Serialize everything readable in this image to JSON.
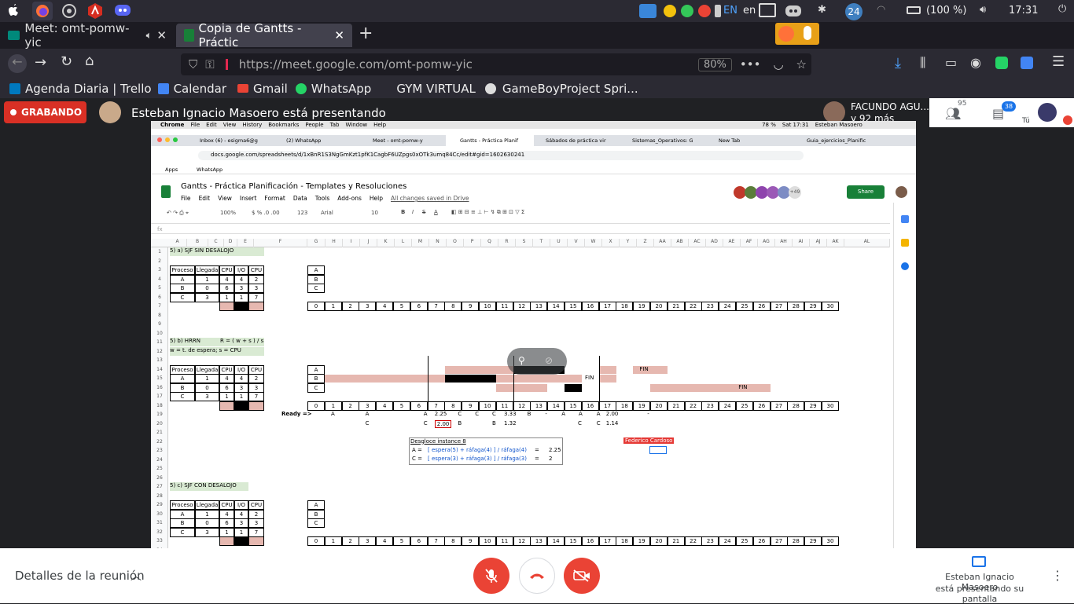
{
  "system": {
    "lang_indicator": "en",
    "battery": "(100 %)",
    "time": "17:31",
    "notif_count": "24"
  },
  "browser": {
    "tabs": [
      {
        "label": "Meet: omt-pomw-yic"
      },
      {
        "label": "Copia de Gantts - Práctic"
      }
    ],
    "url_host": "https://meet.google.com/omt-pomw-yic",
    "zoom": "80%",
    "bookmarks": [
      {
        "label": "Agenda Diaria | Trello"
      },
      {
        "label": "Calendar"
      },
      {
        "label": "Gmail"
      },
      {
        "label": "WhatsApp"
      },
      {
        "label": "GYM VIRTUAL"
      },
      {
        "label": "GameBoyProject Spri..."
      }
    ]
  },
  "meet": {
    "recording_label": "GRABANDO",
    "presenting_text": "Esteban Ignacio Masoero está presentando",
    "participant_name": "FACUNDO AGU...",
    "participant_more": "y 92 más",
    "participants_count": "95",
    "chat_count": "38",
    "you_label": "Tú",
    "meeting_details": "Detalles de la reunión",
    "presenting_status_line1": "Esteban Ignacio Masoero",
    "presenting_status_line2": "está presentando su pantalla"
  },
  "shared_screen": {
    "mac_menu": [
      "Chrome",
      "File",
      "Edit",
      "View",
      "History",
      "Bookmarks",
      "People",
      "Tab",
      "Window",
      "Help"
    ],
    "mac_time": "Sat 17:31",
    "mac_user": "Esteban Masoero",
    "mac_battery": "78 %",
    "chrome_tabs": [
      {
        "label": "Inbox (6) - esigma6@g"
      },
      {
        "label": "(2) WhatsApp"
      },
      {
        "label": "Meet - omt-pomw-y"
      },
      {
        "label": "Gantts - Práctica Planif"
      },
      {
        "label": "Sábados de práctica vir"
      },
      {
        "label": "Sistemas_Operativos: G"
      },
      {
        "label": "New Tab"
      },
      {
        "label": "Guia_ejercicios_Planific"
      }
    ],
    "chrome_url": "docs.google.com/spreadsheets/d/1xBnR1S3NgGmKzt1pfK1CagbF6UZpgs0xOTk3umq84Cc/edit#gid=1602630241",
    "chrome_bookmarks": [
      "Apps",
      "WhatsApp"
    ],
    "doc_title": "Gantts - Práctica Planificación - Templates y Resoluciones",
    "doc_menus": [
      "File",
      "Edit",
      "View",
      "Insert",
      "Format",
      "Data",
      "Tools",
      "Add-ons",
      "Help"
    ],
    "saved_status": "All changes saved in Drive",
    "share_label": "Share",
    "more_collaborators": "+49",
    "toolbar": {
      "zoom": "100%",
      "font": "Arial",
      "size": "10",
      "num_format": "123"
    },
    "fx": "fx",
    "columns": [
      "A",
      "B",
      "C",
      "D",
      "E",
      "F",
      "G",
      "H",
      "I",
      "J",
      "K",
      "L",
      "M",
      "N",
      "O",
      "P",
      "Q",
      "R",
      "S",
      "T",
      "U",
      "V",
      "W",
      "X",
      "Y",
      "Z",
      "AA",
      "AB",
      "AC",
      "AD",
      "AE",
      "AF",
      "AG",
      "AH",
      "AI",
      "AJ",
      "AK",
      "AL"
    ],
    "section1": "5) a) SJF SIN DESALOJO",
    "section2": "5) b) HRRN",
    "section2_formula": "R = ( w + s ) / s",
    "section2_note": "w = t. de espera; s = CPU",
    "section3": "5) c) SJF CON DESALOJO",
    "table_headers": [
      "Proceso",
      "Llegada",
      "CPU",
      "I/O",
      "CPU"
    ],
    "table1": [
      [
        "A",
        "1",
        "4",
        "4",
        "2"
      ],
      [
        "B",
        "0",
        "6",
        "3",
        "3"
      ],
      [
        "C",
        "3",
        "1",
        "1",
        "7"
      ]
    ],
    "table2": [
      [
        "A",
        "1",
        "4",
        "4",
        "2"
      ],
      [
        "B",
        "0",
        "6",
        "3",
        "3"
      ],
      [
        "C",
        "3",
        "1",
        "1",
        "7"
      ]
    ],
    "table3": [
      [
        "A",
        "1",
        "4",
        "4",
        "2"
      ],
      [
        "B",
        "0",
        "6",
        "3",
        "3"
      ],
      [
        "C",
        "3",
        "1",
        "1",
        "7"
      ]
    ],
    "gantt_rows": [
      "A",
      "B",
      "C"
    ],
    "timeline": [
      "0",
      "1",
      "2",
      "3",
      "4",
      "5",
      "6",
      "7",
      "8",
      "9",
      "10",
      "11",
      "12",
      "13",
      "14",
      "15",
      "16",
      "17",
      "18",
      "19",
      "20",
      "21",
      "22",
      "23",
      "24",
      "25",
      "26",
      "27",
      "28",
      "29",
      "30"
    ],
    "ready_label": "Ready =>",
    "ready_row1": [
      "A",
      "A",
      "A",
      "2.25",
      "C",
      "C",
      "C",
      "3.33",
      "B",
      "-",
      "A",
      "A",
      "A",
      "2.00",
      "-"
    ],
    "ready_row2": [
      "C",
      "C",
      "2.00",
      "B",
      "B",
      "1.32",
      "C",
      "C",
      "1.14"
    ],
    "fin_labels": [
      "FIN",
      "FIN",
      "FIN"
    ],
    "desglose_title": "Desgloce instance 8",
    "desglose_rows": [
      {
        "lhs": "A =",
        "expr": "[ espera(5) + ráfaga(4) ] / ráfaga(4)",
        "eq": "=",
        "val": "2.25"
      },
      {
        "lhs": "C =",
        "expr": "[ espera(3) + ráfaga(3) ] / ráfaga(3)",
        "eq": "=",
        "val": "2"
      }
    ],
    "cursor_user": "Federico Cardoso"
  },
  "colors": {
    "record_red": "#d93025",
    "sheets_green": "#188038",
    "pink": "#e6b8b0",
    "meet_red": "#ea4335"
  }
}
